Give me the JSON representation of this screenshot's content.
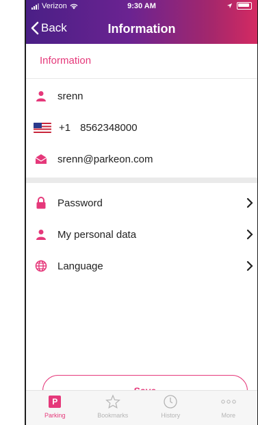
{
  "status_bar": {
    "carrier": "Verizon",
    "time": "9:30 AM"
  },
  "nav": {
    "back_label": "Back",
    "title": "Information"
  },
  "section": {
    "title": "Information"
  },
  "user": {
    "username": "srenn",
    "country_code": "+1",
    "phone": "8562348000",
    "email": "srenn@parkeon.com"
  },
  "menu": [
    {
      "label": "Password",
      "icon": "lock-icon"
    },
    {
      "label": "My personal data",
      "icon": "person-icon"
    },
    {
      "label": "Language",
      "icon": "globe-icon"
    }
  ],
  "save_label": "Save",
  "tabs": [
    {
      "label": "Parking",
      "icon": "parking-icon",
      "active": true
    },
    {
      "label": "Bookmarks",
      "icon": "star-icon",
      "active": false
    },
    {
      "label": "History",
      "icon": "clock-icon",
      "active": false
    },
    {
      "label": "More",
      "icon": "more-icon",
      "active": false
    }
  ],
  "colors": {
    "accent": "#e5387a",
    "header_start": "#4a1f86",
    "header_end": "#d42a62"
  }
}
